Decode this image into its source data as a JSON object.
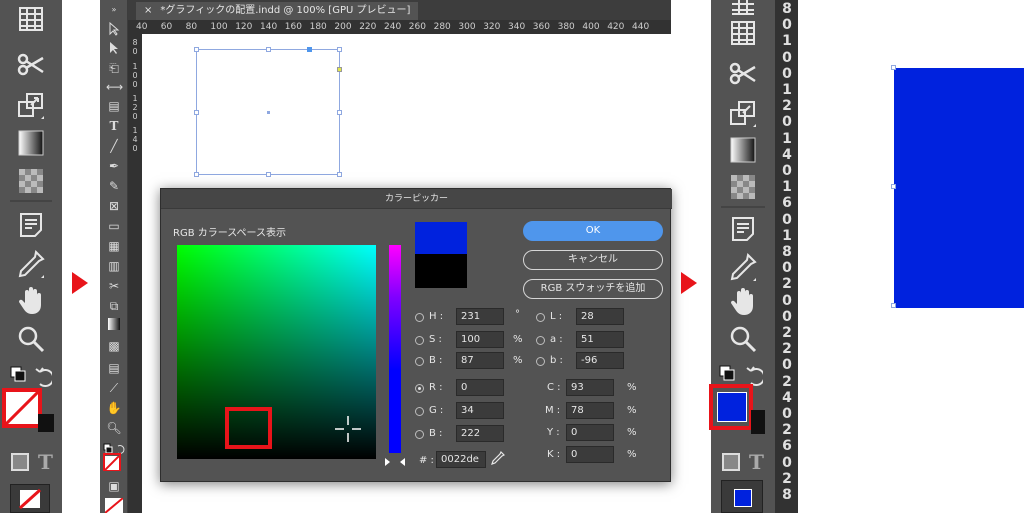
{
  "colors": {
    "highlight": "#e8141a",
    "accent": "#4f96ec",
    "fill_blue": "#0022de",
    "ui_dark": "#535353"
  },
  "left_tools": [
    "frame-grid-icon",
    "scissors-icon",
    "free-transform-icon",
    "gradient-swatch-icon",
    "gradient-feather-icon",
    "note-icon",
    "eyedropper-icon",
    "hand-icon",
    "zoom-icon",
    "fill-stroke-swap-icon",
    "fill-none-swatch-icon",
    "normal-mode-icon",
    "formatting-text-icon",
    "fill-none-small-icon"
  ],
  "document": {
    "tab_close": "×",
    "tab_title": "*グラフィックの配置.indd @ 100% [GPU プレビュー]"
  },
  "ruler_h": [
    "40",
    "60",
    "80",
    "100",
    "120",
    "140",
    "160",
    "180",
    "200",
    "220",
    "240",
    "260",
    "280",
    "300",
    "320",
    "340",
    "360",
    "380",
    "400",
    "420",
    "440"
  ],
  "ruler_v": [
    "8",
    "0",
    "1",
    "0",
    "0",
    "1",
    "2",
    "0",
    "1",
    "4",
    "0"
  ],
  "dialog": {
    "title": "カラーピッカー",
    "space_label": "RGB カラースペース表示",
    "buttons": {
      "ok": "OK",
      "cancel": "キャンセル",
      "add_swatch": "RGB スウォッチを追加"
    },
    "fields": {
      "h": {
        "label": "H :",
        "value": "231",
        "unit": "°"
      },
      "s": {
        "label": "S :",
        "value": "100",
        "unit": "%"
      },
      "b": {
        "label": "B :",
        "value": "87",
        "unit": "%"
      },
      "l": {
        "label": "L :",
        "value": "28"
      },
      "a": {
        "label": "a :",
        "value": "51"
      },
      "lab_b": {
        "label": "b :",
        "value": "-96"
      },
      "r": {
        "label": "R :",
        "value": "0"
      },
      "g": {
        "label": "G :",
        "value": "34"
      },
      "rgb_b": {
        "label": "B :",
        "value": "222"
      },
      "c": {
        "label": "C :",
        "value": "93",
        "unit": "%"
      },
      "m": {
        "label": "M :",
        "value": "78",
        "unit": "%"
      },
      "y": {
        "label": "Y :",
        "value": "0",
        "unit": "%"
      },
      "k": {
        "label": "K :",
        "value": "0",
        "unit": "%"
      },
      "hex": {
        "label": "# :",
        "value": "0022de"
      }
    }
  },
  "right_ruler": [
    "8",
    "0",
    "1",
    "0",
    "0",
    "1",
    "2",
    "0",
    "1",
    "4",
    "0",
    "1",
    "6",
    "0",
    "1",
    "8",
    "0",
    "2",
    "0",
    "0",
    "2",
    "2",
    "0",
    "2",
    "4",
    "0",
    "2",
    "6",
    "0",
    "2",
    "8"
  ]
}
